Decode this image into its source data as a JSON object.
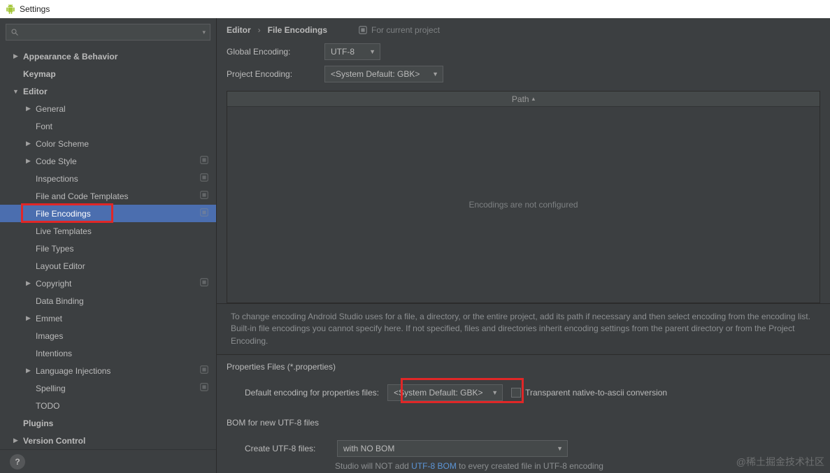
{
  "titlebar": {
    "title": "Settings"
  },
  "search": {
    "placeholder": ""
  },
  "breadcrumb": {
    "crumb1": "Editor",
    "crumb2": "File Encodings",
    "scope": "For current project"
  },
  "sidebar": {
    "items": [
      {
        "label": "Appearance & Behavior",
        "depth": 0,
        "bold": true,
        "chevron": "right"
      },
      {
        "label": "Keymap",
        "depth": 0,
        "bold": true
      },
      {
        "label": "Editor",
        "depth": 0,
        "bold": true,
        "chevron": "down"
      },
      {
        "label": "General",
        "depth": 1,
        "chevron": "right"
      },
      {
        "label": "Font",
        "depth": 1
      },
      {
        "label": "Color Scheme",
        "depth": 1,
        "chevron": "right"
      },
      {
        "label": "Code Style",
        "depth": 1,
        "chevron": "right",
        "scope": true
      },
      {
        "label": "Inspections",
        "depth": 1,
        "scope": true
      },
      {
        "label": "File and Code Templates",
        "depth": 1,
        "scope": true
      },
      {
        "label": "File Encodings",
        "depth": 1,
        "scope": true,
        "selected": true,
        "highlight": true
      },
      {
        "label": "Live Templates",
        "depth": 1
      },
      {
        "label": "File Types",
        "depth": 1
      },
      {
        "label": "Layout Editor",
        "depth": 1
      },
      {
        "label": "Copyright",
        "depth": 1,
        "chevron": "right",
        "scope": true
      },
      {
        "label": "Data Binding",
        "depth": 1
      },
      {
        "label": "Emmet",
        "depth": 1,
        "chevron": "right"
      },
      {
        "label": "Images",
        "depth": 1
      },
      {
        "label": "Intentions",
        "depth": 1
      },
      {
        "label": "Language Injections",
        "depth": 1,
        "chevron": "right",
        "scope": true
      },
      {
        "label": "Spelling",
        "depth": 1,
        "scope": true
      },
      {
        "label": "TODO",
        "depth": 1
      },
      {
        "label": "Plugins",
        "depth": 0,
        "bold": true
      },
      {
        "label": "Version Control",
        "depth": 0,
        "bold": true,
        "chevron": "right"
      }
    ]
  },
  "encoding": {
    "global_label": "Global Encoding:",
    "global_value": "UTF-8",
    "project_label": "Project Encoding:",
    "project_value": "<System Default: GBK>",
    "table_header": "Path",
    "table_empty": "Encodings are not configured",
    "info_text": "To change encoding Android Studio uses for a file, a directory, or the entire project, add its path if necessary and then select encoding from the encoding list. Built-in file encodings you cannot specify here. If not specified, files and directories inherit encoding settings from the parent directory or from the Project Encoding."
  },
  "properties": {
    "section_title": "Properties Files (*.properties)",
    "default_label": "Default encoding for properties files:",
    "default_value": "<System Default: GBK>",
    "checkbox_label": "Transparent native-to-ascii conversion"
  },
  "bom": {
    "section_title": "BOM for new UTF-8 files",
    "create_label": "Create UTF-8 files:",
    "create_value": "with NO BOM",
    "hint_pre": "Studio will NOT add ",
    "hint_link": "UTF-8 BOM",
    "hint_post": " to every created file in UTF-8 encoding"
  },
  "watermark": "@稀土掘金技术社区"
}
